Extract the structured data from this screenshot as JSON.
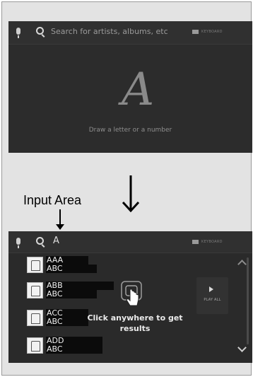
{
  "top_screen": {
    "search_placeholder": "Search for artists, albums, etc",
    "keyboard_label": "KEYBOARD",
    "drawn_glyph": "A",
    "draw_hint": "Draw a letter or a number"
  },
  "annotation": {
    "input_area_label": "Input Area"
  },
  "bottom_screen": {
    "typed_value": "A",
    "keyboard_label": "KEYBOARD",
    "results": [
      {
        "title": "AAA",
        "subtitle": "ABC"
      },
      {
        "title": "ABB",
        "subtitle": "ABC"
      },
      {
        "title": "ACC",
        "subtitle": "ABC"
      },
      {
        "title": "ADD",
        "subtitle": "ABC"
      }
    ],
    "play_all_label": "PLAY ALL",
    "click_hint_line1": "Click anywhere to get",
    "click_hint_line2": "results"
  }
}
